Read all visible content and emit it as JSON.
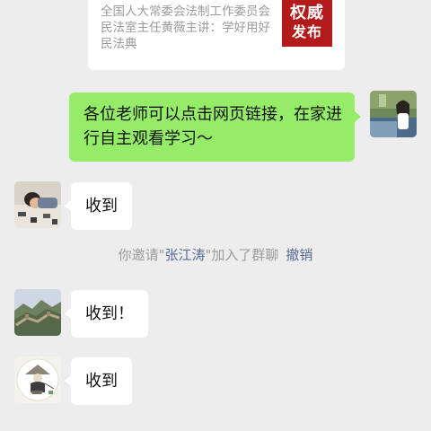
{
  "link_card": {
    "description": "全国人大常委会法制工作委员会民法室主任黄薇主讲：学好用好民法典",
    "thumbnail_line1": "权威",
    "thumbnail_line2": "发布",
    "thumbnail_color": "#b31a1a"
  },
  "messages": {
    "outgoing": {
      "text": "各位老师可以点击网页链接，在家进行自主观看学习～"
    },
    "incoming_1": {
      "text": "收到"
    },
    "incoming_2": {
      "text": "收到！"
    },
    "incoming_3": {
      "text": "收到"
    }
  },
  "system": {
    "prefix": "你邀请\"",
    "name": "张江涛",
    "suffix": "\"加入了群聊",
    "action": "撤销"
  },
  "colors": {
    "background": "#ededed",
    "outgoing_bubble": "#95ec69",
    "incoming_bubble": "#ffffff",
    "link": "#576b95",
    "muted_text": "#9a9a9a"
  },
  "icons": {
    "my_avatar": "photo-avatar-girl-by-stream",
    "user1_avatar": "photo-avatar-child-lying",
    "user2_avatar": "photo-avatar-great-wall",
    "user3_avatar": "illustration-avatar-fisherman"
  }
}
